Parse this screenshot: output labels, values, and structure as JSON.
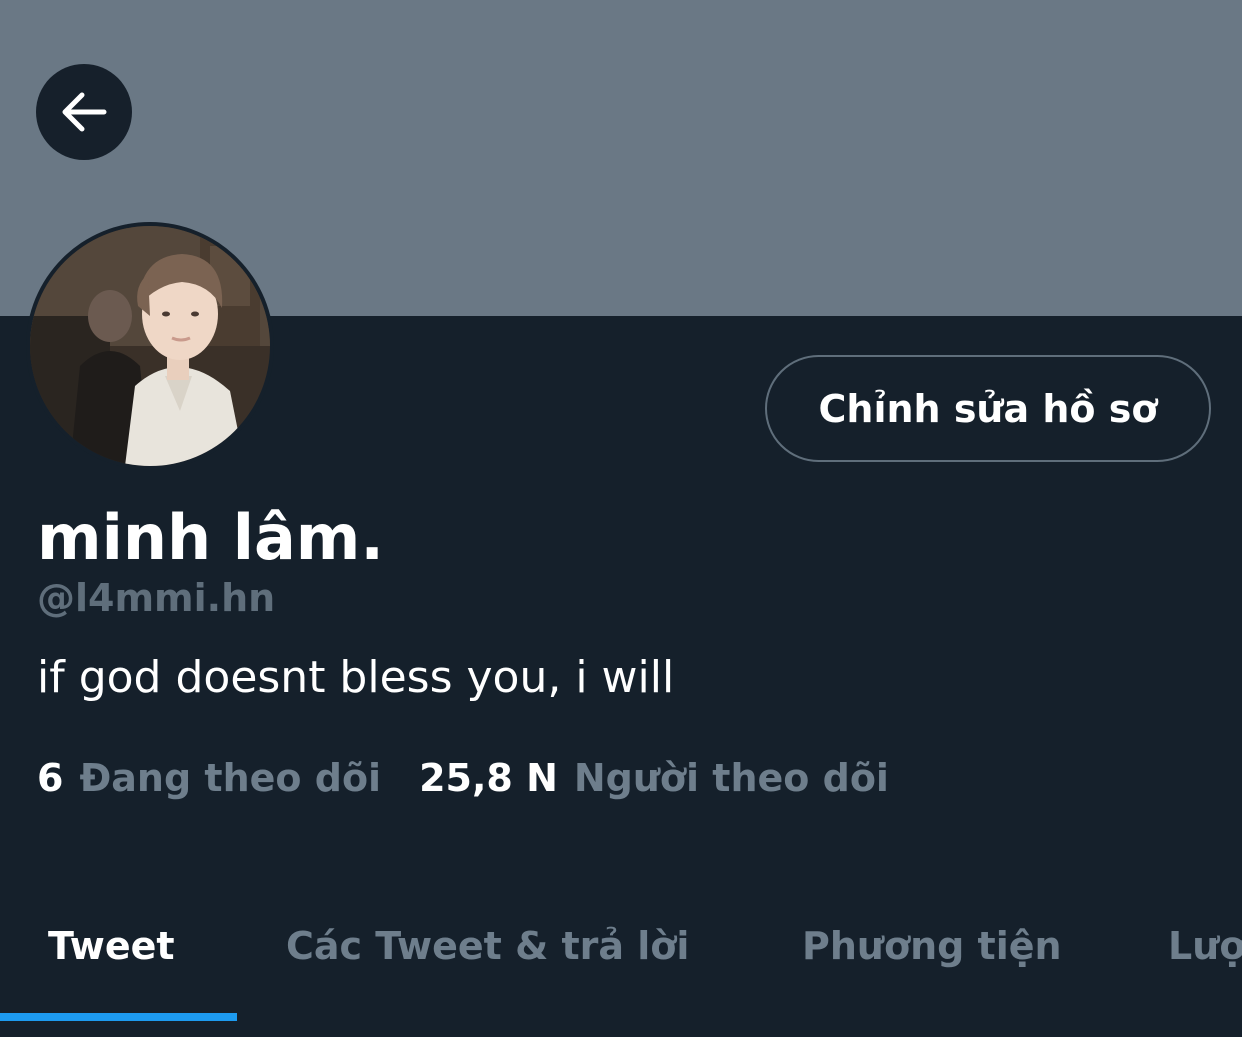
{
  "profile": {
    "display_name": "minh lâm.",
    "handle": "@l4mmi.hn",
    "bio": "if god doesnt bless you, i will",
    "edit_button_label": "Chỉnh sửa hồ sơ"
  },
  "stats": {
    "following_count": "6",
    "following_label": "Đang theo dõi",
    "followers_count": "25,8 N",
    "followers_label": "Người theo dõi"
  },
  "tabs": [
    {
      "label": "Tweet",
      "active": true
    },
    {
      "label": "Các Tweet & trả lời",
      "active": false
    },
    {
      "label": "Phương tiện",
      "active": false
    },
    {
      "label": "Lượt thích",
      "active": false
    }
  ],
  "icons": {
    "back": "arrow-left-icon"
  },
  "colors": {
    "background": "#15202b",
    "banner": "#6a7885",
    "accent": "#1d9bf0",
    "secondary_text": "#6e7e8c"
  }
}
